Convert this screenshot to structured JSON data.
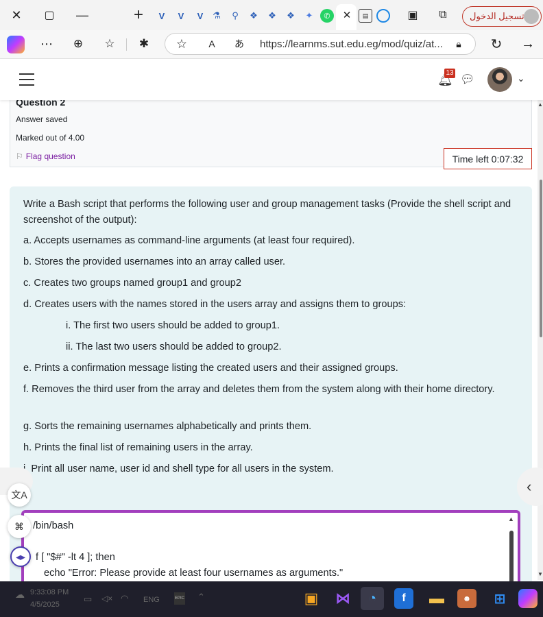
{
  "browser": {
    "tab_icons": [
      "V",
      "V",
      "V",
      "flask",
      "search",
      "copilot",
      "copilot",
      "copilot",
      "sparkle",
      "whatsapp"
    ],
    "signin_label": "تسجيل الدخول",
    "url": "https://learnms.sut.edu.eg/mod/quiz/at...",
    "read_aloud": "A",
    "translate": "あ"
  },
  "header": {
    "notification_count": "13"
  },
  "question": {
    "heading": "Question 2",
    "status": "Answer saved",
    "marks": "Marked out of 4.00",
    "flag_label": "Flag question",
    "timer": "Time left 0:07:32"
  },
  "content": {
    "intro": "Write a Bash script that performs the following user and group management tasks (Provide the shell script and screenshot of the output):",
    "items": [
      "a. Accepts usernames as command-line arguments (at least four required).",
      "b. Stores the provided usernames into an array called user.",
      "c. Creates two groups named group1 and group2",
      "d. Creates users with the names stored in the users array and assigns them to groups:",
      "i. The first two users should be added to group1.",
      "ii. The last two users should be added to group2.",
      "e. Prints a confirmation message listing the created users and their assigned groups.",
      "f. Removes the third user from the array and deletes them from the system along with their home directory.",
      "g. Sorts the remaining usernames alphabetically and prints them.",
      "h. Prints the final list of remaining users in the array.",
      "i. Print all user name, user id and shell type for all users in the system."
    ]
  },
  "editor": {
    "line1": "/bin/bash",
    "line2": "f [ \"$#\" -lt 4 ]; then",
    "line3": "echo \"Error: Please provide at least four usernames as arguments.\""
  },
  "taskbar": {
    "time": "9:33:08 PM",
    "date": "4/5/2025",
    "lang": "ENG"
  }
}
